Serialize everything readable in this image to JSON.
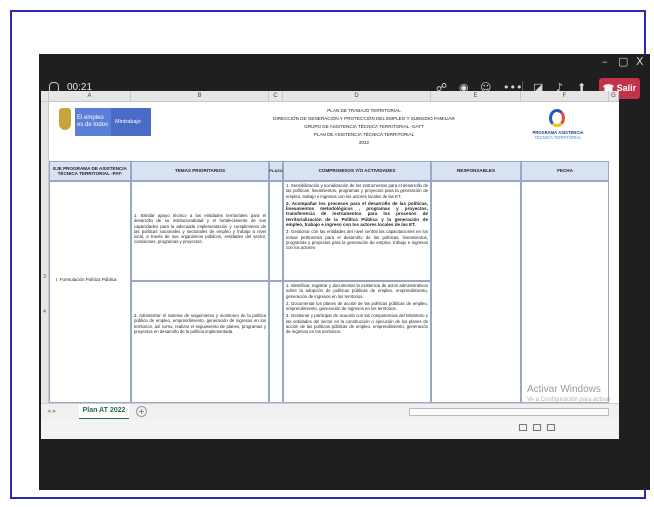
{
  "window": {
    "controls": {
      "minimize": "–",
      "maximize": "▢",
      "close": "X"
    }
  },
  "meeting": {
    "timer": "00:21",
    "leave_label": "Salir",
    "leave_color": "#c4314b",
    "toolbar_icons": [
      "people-icon",
      "chat-icon",
      "reactions-icon",
      "more-icon",
      "camera-off-icon",
      "mic-icon",
      "share-icon",
      "phone-icon"
    ]
  },
  "spreadsheet": {
    "columns": [
      "A",
      "B",
      "C",
      "D",
      "E",
      "F",
      "G"
    ],
    "row_numbers": [
      "",
      "",
      "",
      "",
      "",
      "",
      "",
      "3",
      "4"
    ],
    "logo": {
      "line1": "El empleo",
      "line2": "es de todos",
      "brand": "Mintrabajo"
    },
    "header_lines": [
      "PLAN DE TRABAJO TERRITORIAL",
      "DIRECCIÓN DE GENERACIÓN Y PROTECCIÓN DEL EMPLEO Y SUBSIDIO FAMILIAR",
      "GRUPO DE ASISTENCIA TÉCNICA TERRITORIAL -GATT",
      "PLAN DE ASISTENCIA TÉCNICA TERRITORIAL",
      "2022"
    ],
    "program_logo": {
      "line1": "PROGRAMA ASISTENCIA",
      "line2": "TÉCNICA TERRITORIAL"
    },
    "table_headers": [
      "EJE PROGRAMA DE ASISTENCIA TÉCNICA TERRITORIAL -PAT-",
      "TEMAS PRIORITARIOS",
      "PLAZO",
      "COMPROMISOS Y/O ACTIVIDADES",
      "RESPONSABLES",
      "FECHA"
    ],
    "eje": "I. Formulación Política Pública",
    "temas": [
      "1. Brindar apoyo técnico a las entidades territoriales para el desarrollo de su institucionalidad y el fortalecimiento de sus capacidades para la adecuada implementación y cumplimiento de las políticas nacionales y sectoriales de empleo y trabajo a nivel local, a través de sus organismos públicos, entidades del sector, comisiones, programas y proyectos.",
      "3. Administrar el sistema de seguimiento y monitoreo de la política pública de empleo, emprendimiento, generación de ingresos en los territorios, así como, realizar el seguimiento de planes, programas y proyectos en desarrollo de la política implementada."
    ],
    "compromisos_1": [
      "1. Sensibilización y socialización de los instrumentos para el desarrollo de las políticas, lineamientos, programas y proyectos para la generación de empleo, trabajo e ingresos con los actores locales de las ET.",
      "2. Acompañar los procesos para el desarrollo de las políticas, lineamientos metodológicos , programas y proyectos, transferencia de instrumentos para los procesos de territorialización de la Política Pública y la generación de empleo, trabajo e ingreso con los actores locales de las ET.",
      "3. Gestionar con las entidades del nivel central las capacitaciones en los temas pertinentes para el desarrollo de las políticas, lineamientos, programas y proyectos para la generación de empleo, trabajo e ingresos con los actores"
    ],
    "compromisos_2": [
      "1. Identificar, registrar y documentar la existencia de actos administrativos sobre la adopción de políticas públicas de empleo, emprendimiento, generación de ingresos en los territorios.",
      "2. Documentar los planes de acción de las políticas públicas de empleo, emprendimiento, generación de ingresos en los territorios.",
      "3. Gestionar y participar de acuerdo con las competencias del Ministerio y las entidades del sector en la construcción o ejecución de los planes de acción de las políticas públicas de empleo, emprendimiento, generación de ingresos en los territorios."
    ],
    "sheet_tab": "Plan AT 2022",
    "add_sheet": "+",
    "tab_nav": "◂ ▸"
  },
  "watermark": {
    "line1": "Activar Windows",
    "line2": "Ve a Configuración para activar Windows."
  }
}
